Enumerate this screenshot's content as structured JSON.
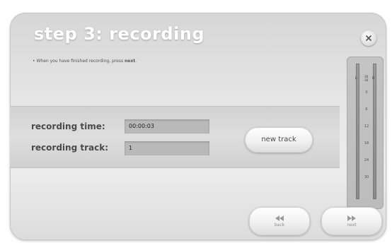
{
  "dialog": {
    "title": "step 3: recording",
    "instruction_prefix": "When you have finished recording, press ",
    "instruction_keyword": "next",
    "instruction_suffix": ".",
    "close_icon": "close-icon"
  },
  "fields": {
    "recording_time_label": "recording time:",
    "recording_time_value": "00:00:03",
    "recording_track_label": "recording track:",
    "recording_track_value": "1"
  },
  "buttons": {
    "new_track": "new track",
    "back": "back",
    "next": "next",
    "back_icon": "rewind-icon",
    "next_icon": "fast-forward-icon"
  },
  "meter": {
    "left_channel": "L",
    "right_channel": "R",
    "top_labels": [
      "-36",
      "-36"
    ],
    "scale": [
      "0",
      "6",
      "12",
      "18",
      "24",
      "30"
    ]
  },
  "colors": {
    "title_text": "#ffffff",
    "field_background": "#b9b9b9",
    "panel_background": "#e6e6e6"
  }
}
